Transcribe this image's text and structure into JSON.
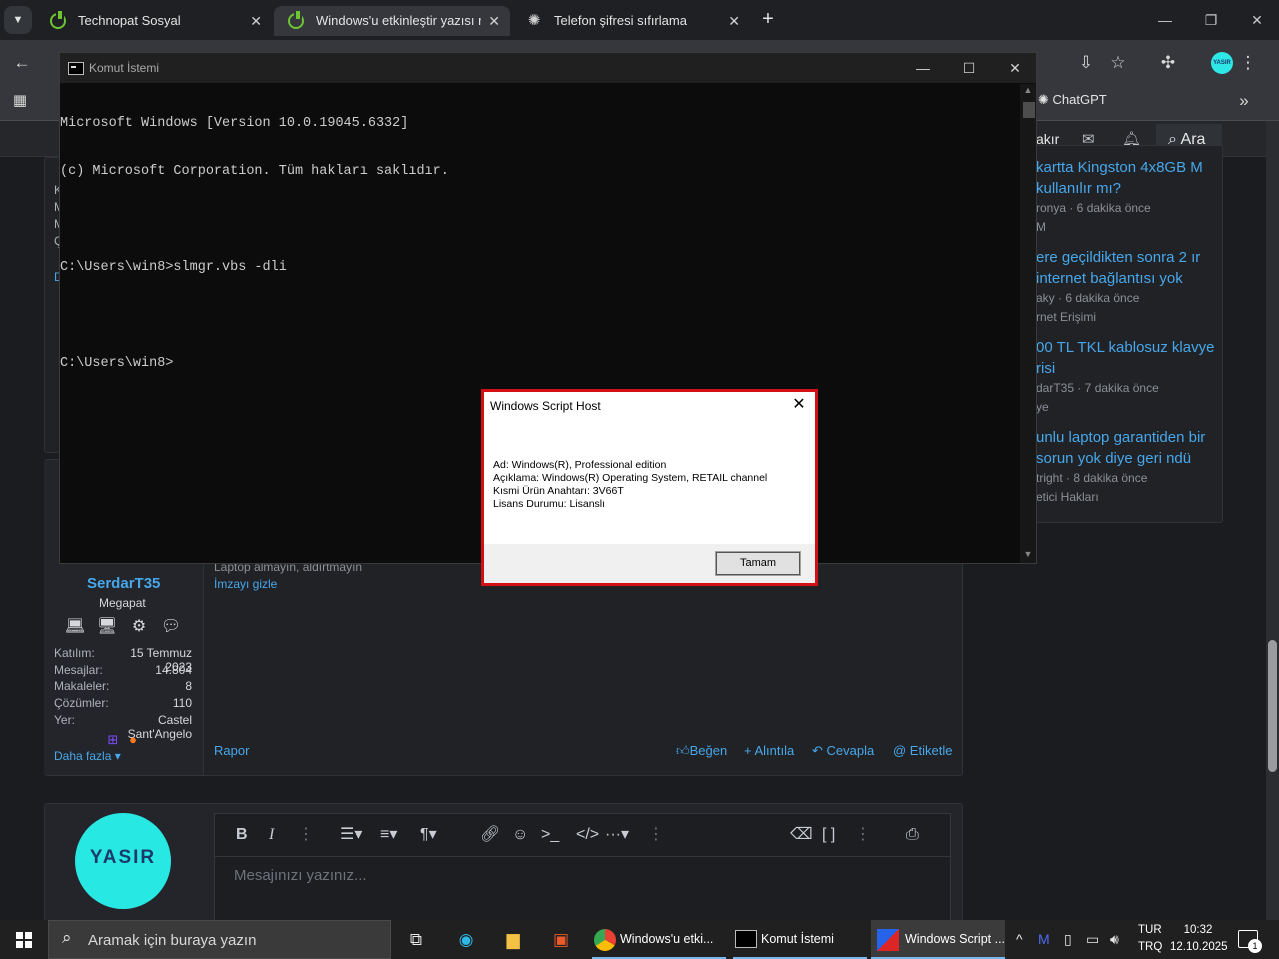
{
  "browser": {
    "tabs": [
      {
        "title": "Technopat Sosyal",
        "close": "✕"
      },
      {
        "title": "Windows'u etkinleştir yazısı nası",
        "close": "✕"
      },
      {
        "title": "Telefon şifresi sıfırlama",
        "close": "✕"
      }
    ],
    "new_tab": "+",
    "bookmark_chatgpt": "ChatGPT",
    "profile_initials": "YASIR"
  },
  "forum": {
    "nav_text": "akır",
    "search_label": "Ara",
    "sidebar": [
      {
        "title": "kartta Kingston 4x8GB M kullanılır mı?",
        "meta": "ronya · 6 dakika önce",
        "forum": "M"
      },
      {
        "title": "ere geçildikten sonra 2 ır internet bağlantısı yok",
        "meta": "aky · 6 dakika önce",
        "forum": "rnet Erişimi"
      },
      {
        "title": "00 TL TKL kablosuz klavye risi",
        "meta": "darT35 · 7 dakika önce",
        "forum": "ye"
      },
      {
        "title": "unlu laptop garantiden bir sorun yok diye geri ndü",
        "meta": "tright · 8 dakika önce",
        "forum": "etici Hakları"
      }
    ],
    "left_letters": [
      "K",
      "M",
      "M",
      "Ç",
      "D"
    ],
    "user": {
      "name": "SerdarT35",
      "title": "Megapat",
      "stats": [
        {
          "label": "Katılım:",
          "value": "15 Temmuz 2023"
        },
        {
          "label": "Mesajlar:",
          "value": "14.804"
        },
        {
          "label": "Makaleler:",
          "value": "8"
        },
        {
          "label": "Çözümler:",
          "value": "110"
        },
        {
          "label": "Yer:",
          "value": "Castel Sant'Angelo"
        }
      ],
      "more": "Daha fazla ▾"
    },
    "post": {
      "signature": "Laptop almayın, aldırtmayın",
      "hide_signature": "İmzayı gizle",
      "report": "Rapor",
      "like": "Beğen",
      "quote": "+ Alıntıla",
      "reply": "Cevapla",
      "tag": "@ Etiketle"
    },
    "editor": {
      "avatar_text": "YASIR",
      "placeholder": "Mesajınızı yazınız..."
    }
  },
  "console": {
    "title": "Komut İstemi",
    "lines": [
      "Microsoft Windows [Version 10.0.19045.6332]",
      "(c) Microsoft Corporation. Tüm hakları saklıdır.",
      "",
      "C:\\Users\\win8>slmgr.vbs -dli",
      "",
      "C:\\Users\\win8>"
    ]
  },
  "dialog": {
    "title": "Windows Script Host",
    "close": "✕",
    "lines": [
      "Ad: Windows(R), Professional edition",
      "Açıklama: Windows(R) Operating System, RETAIL channel",
      "Kısmi Ürün Anahtarı: 3V66T",
      "Lisans Durumu: Lisanslı"
    ],
    "ok_button": "Tamam"
  },
  "taskbar": {
    "search_placeholder": "Aramak için buraya yazın",
    "tasks": [
      {
        "label": "Windows'u etki..."
      },
      {
        "label": "Komut İstemi"
      },
      {
        "label": "Windows Script ..."
      }
    ],
    "lang_top": "TUR",
    "lang_bottom": "TRQ",
    "time": "10:32",
    "date": "12.10.2025",
    "notification_count": "1"
  }
}
